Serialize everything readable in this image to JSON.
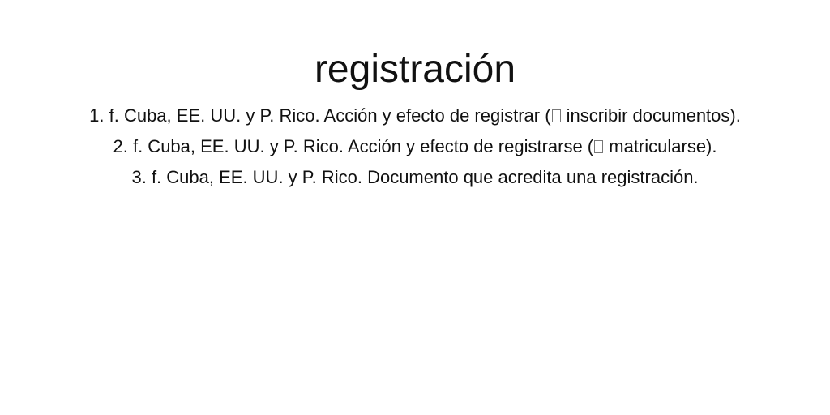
{
  "entry": {
    "headword": "registración",
    "senses": [
      {
        "number": "1.",
        "text_before": "f. Cuba, EE. UU. y P. Rico. Acción y efecto de registrar (",
        "ref_icon": "cross-reference-box-icon",
        "text_after": " inscribir documentos)."
      },
      {
        "number": "2.",
        "text_before": "f. Cuba, EE. UU. y P. Rico. Acción y efecto de registrarse (",
        "ref_icon": "cross-reference-box-icon",
        "text_after": " matricularse)."
      },
      {
        "number": "3.",
        "text": "f. Cuba, EE. UU. y P. Rico. Documento que acredita una registración."
      }
    ]
  }
}
